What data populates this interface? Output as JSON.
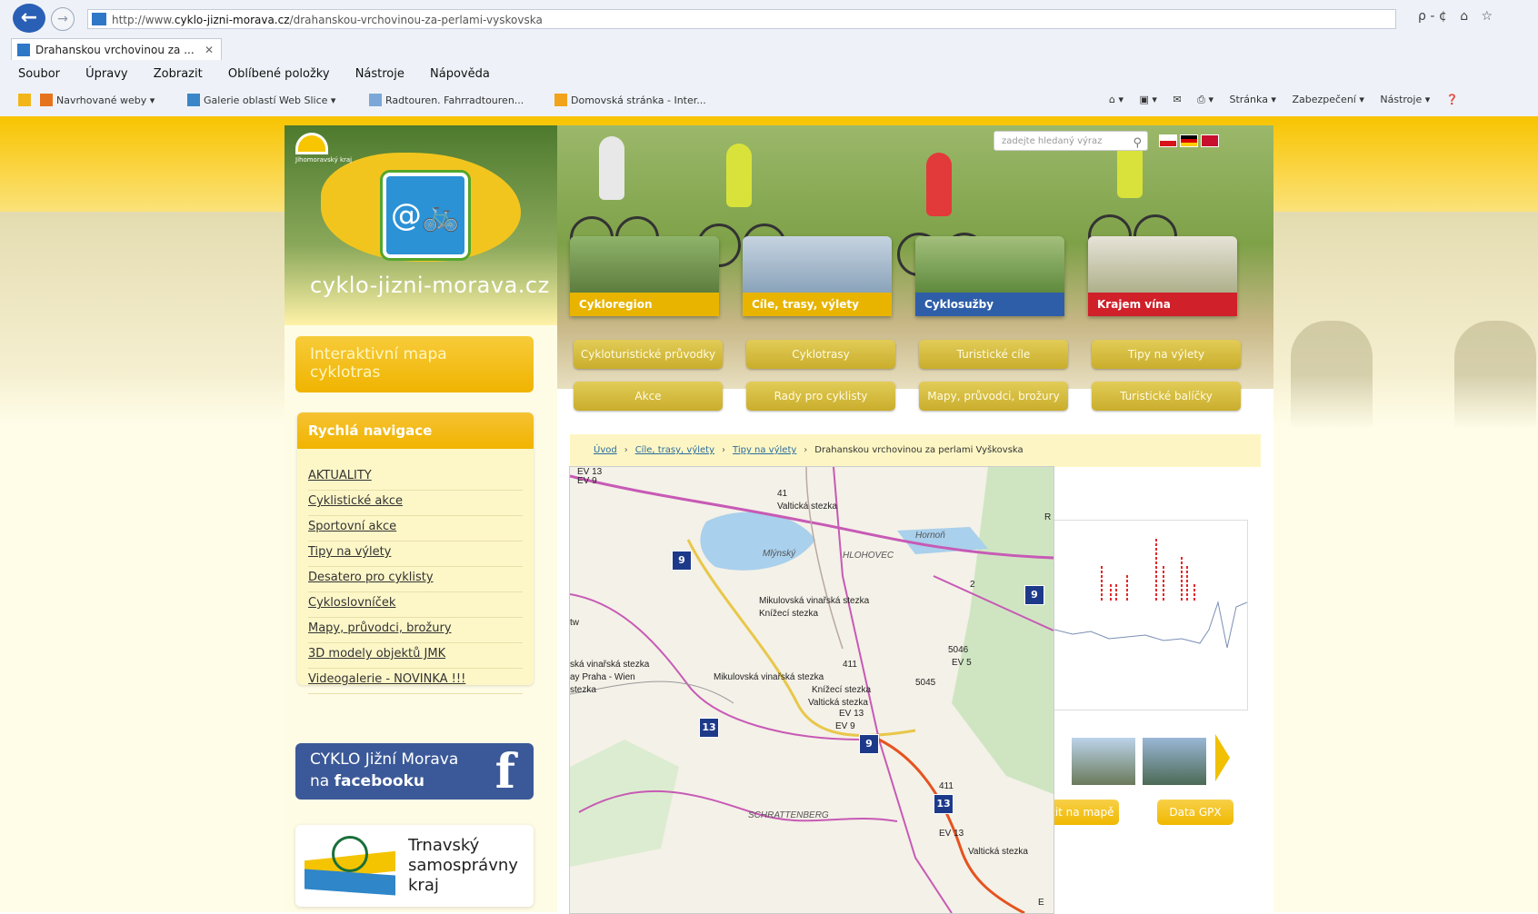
{
  "browser": {
    "url_prefix": "http://www.",
    "url_domain": "cyklo-jizni-morava.cz",
    "url_path": "/drahanskou-vrchovinou-za-perlami-vyskovska",
    "tab_title": "Drahanskou vrchovinou za ...",
    "tab_close": "✕",
    "addr_search_icon": "ρ - ¢",
    "menu": [
      "Soubor",
      "Úpravy",
      "Zobrazit",
      "Oblíbené položky",
      "Nástroje",
      "Nápověda"
    ],
    "favorites": [
      "Navrhované weby ▾",
      "Galerie oblastí Web Slice ▾",
      "Radtouren. Fahrradtouren...",
      "Domovská stránka - Inter..."
    ],
    "command_bar": [
      "Stránka ▾",
      "Zabezpečení ▾",
      "Nástroje ▾"
    ]
  },
  "site": {
    "logo_caption": "Jihomoravský kraj",
    "site_name": "cyklo-jizni-morava.cz",
    "map_button": "Interaktivní mapa cyklotras",
    "search_placeholder": "zadejte hledaný výraz",
    "quick_nav_title": "Rychlá navigace",
    "quick_nav": [
      "AKTUALITY",
      "Cyklistické akce",
      "Sportovní akce",
      "Tipy na výlety",
      "Desatero pro cyklisty",
      "Cykloslovníček",
      "Mapy, průvodci, brožury",
      "3D modely objektů JMK",
      "Videogalerie - NOVINKA !!!"
    ],
    "facebook_line1": "CYKLO Jižní Morava",
    "facebook_line2_a": "na ",
    "facebook_line2_b": "facebooku",
    "facebook_icon": "f",
    "ttsk_l1": "Trnavský",
    "ttsk_l2": "samosprávny",
    "ttsk_l3": "kraj",
    "categories": [
      {
        "label": "Cykloregion",
        "color": "#e8b400"
      },
      {
        "label": "Cíle, trasy, výlety",
        "color": "#e8b400"
      },
      {
        "label": "Cyklosužby",
        "color": "#2f5ea8"
      },
      {
        "label": "Krajem vína",
        "color": "#d0202a"
      }
    ],
    "sub_buttons_row1": [
      "Cykloturistické průvodky",
      "Cyklotrasy",
      "Turistické cíle",
      "Tipy na výlety"
    ],
    "sub_buttons_row2": [
      "Akce",
      "Rady pro cyklisty",
      "Mapy, průvodci, brožury",
      "Turistické balíčky"
    ],
    "breadcrumb": [
      "Úvod",
      "Cíle, trasy, výlety",
      "Tipy na výlety",
      "Drahanskou vrchovinou za perlami Vyškovska"
    ],
    "show_on_map": "zit na mapě",
    "gpx_button": "Data GPX"
  },
  "map_labels": {
    "ev13a": "EV 13",
    "ev9a": "EV 9",
    "v41": "41",
    "valticka1": "Valtická stezka",
    "mlynsky": "Mlýnský",
    "hlohovec": "HLOHOVEC",
    "mik1": "Mikulovská vinařská stezka",
    "kniz1": "Knížecí stezka",
    "mik2": "Mikulovská vinařská stezka",
    "kniz2": "Knížecí stezka",
    "valticka2": "Valtická stezka",
    "praha": "ay Praha - Wien",
    "vinarska": "ská vinařská stezka",
    "stezka": "stezka",
    "v411a": "411",
    "v5046": "5046",
    "ev5": "EV 5",
    "v5045": "5045",
    "ev13b": "EV 13",
    "ev9b": "EV 9",
    "schrattenberg": "SCHRATTENBERG",
    "v411b": "411",
    "ev13c": "EV 13",
    "valticka3": "Valtická stezka",
    "s9a": "9",
    "s9b": "9",
    "s9c": "9",
    "s13a": "13",
    "s13b": "13",
    "rd2": "2",
    "w": "tw",
    "hornon": "Hornoň",
    "r": "R",
    "e": "E"
  }
}
